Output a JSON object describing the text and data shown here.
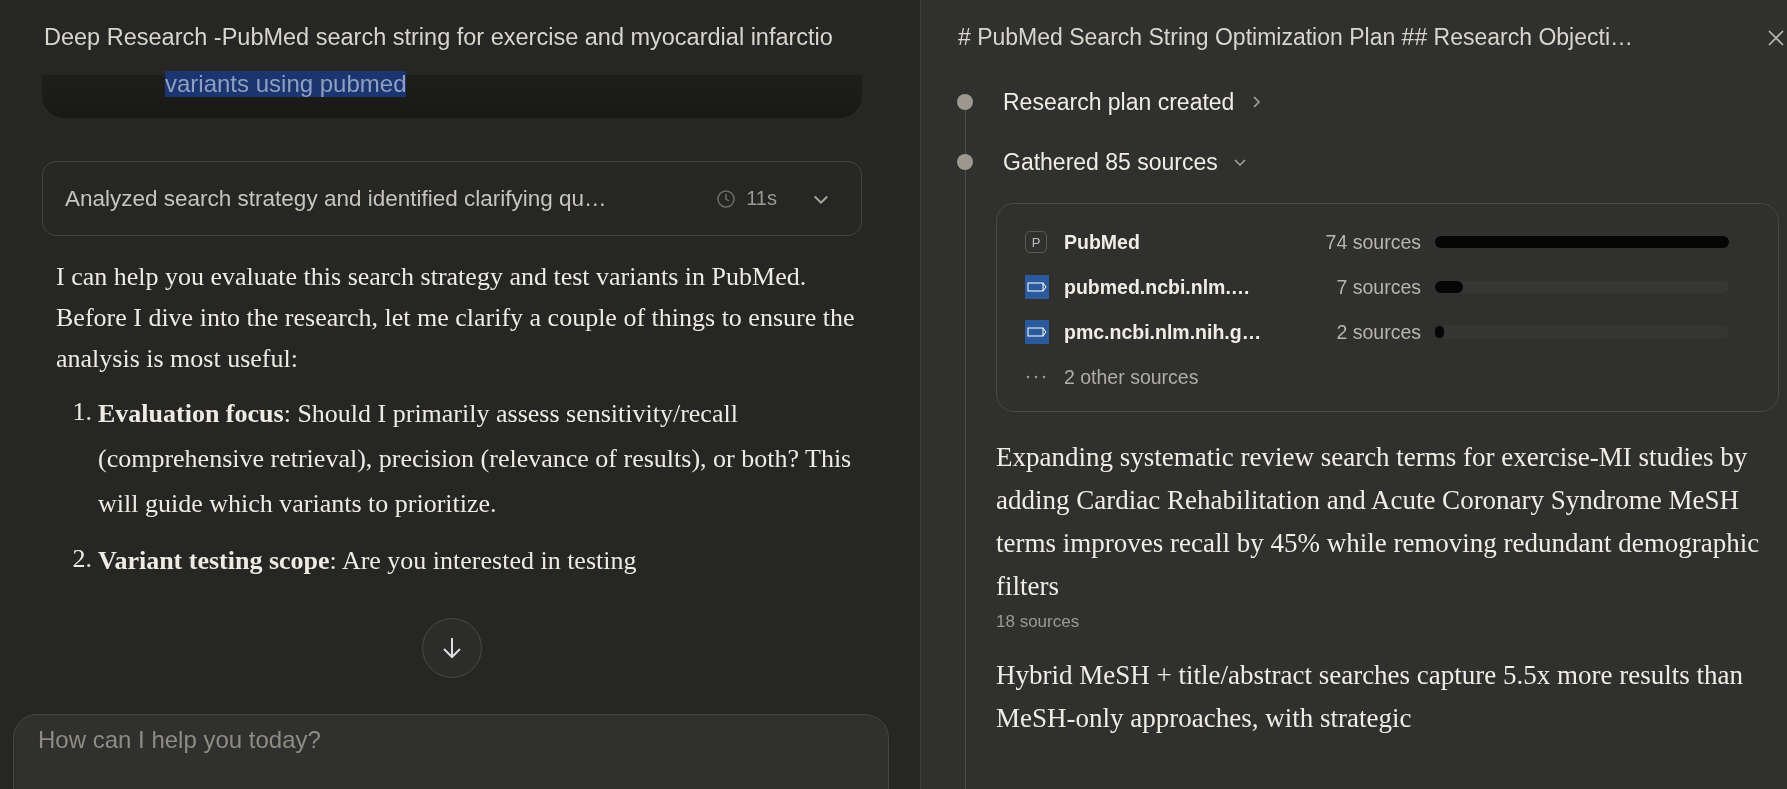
{
  "chat_panel": {
    "title": "Deep Research -PubMed search string for exercise and myocardial infarctio",
    "prompt_excerpt": {
      "text": "variants using pubmed",
      "highlighted": true
    },
    "thinking_summary": {
      "text": "Analyzed search strategy and identified clarifying qu…",
      "duration": "11s",
      "expanded": false
    },
    "response": {
      "intro": "I can help you evaluate this search strategy and test variants in PubMed. Before I dive into the research, let me clarify a couple of things to ensure the analysis is most useful:",
      "list": [
        {
          "number": "1.",
          "text": "**Evaluation focus**: Should I primarily assess sensitivity/recall (comprehensive retrieval), precision (relevance of results), or both? This will guide which variants to prioritize."
        },
        {
          "number": "2.",
          "text": "**Variant testing scope**: Are you interested in testing"
        }
      ]
    },
    "message_input": {
      "placeholder": "How can I help you today?"
    }
  },
  "research_panel": {
    "title": "# PubMed Search String Optimization Plan ## Research Objecti…",
    "steps": [
      {
        "label": "Research plan created",
        "expanded": false
      },
      {
        "label": "Gathered 85 sources",
        "expanded": true
      }
    ],
    "sources": [
      {
        "kind": "letter",
        "icon_letter": "P",
        "name": "PubMed",
        "count": "74 sources",
        "level": 1
      },
      {
        "kind": "site",
        "name": "pubmed.ncbi.nlm.…",
        "count": "7 sources",
        "level": 0.095
      },
      {
        "kind": "site",
        "name": "pmc.ncbi.nlm.nih.g…",
        "count": "2 sources",
        "level": 0.03
      },
      {
        "kind": "more",
        "name": "2 other sources"
      }
    ],
    "findings": [
      {
        "text": "Expanding systematic review search terms for exercise-MI studies by adding Cardiac Rehabilitation and Acute Coronary Syndrome MeSH terms improves recall by 45% while removing redundant demographic filters",
        "sources": "18 sources"
      },
      {
        "text": "Hybrid MeSH + title/abstract searches capture 5.5x more results than MeSH-only approaches, with strategic"
      }
    ]
  }
}
